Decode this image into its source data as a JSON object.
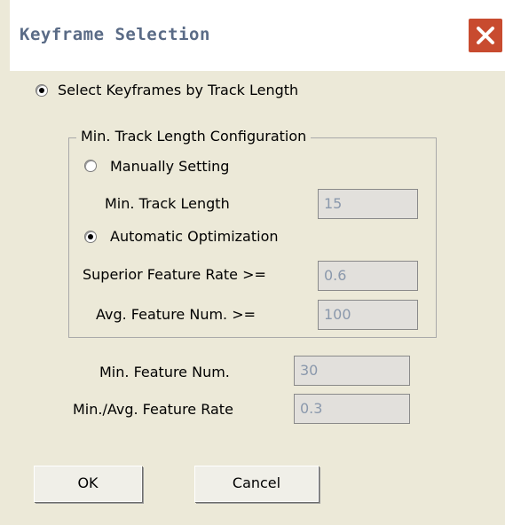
{
  "window": {
    "title": "Keyframe Selection",
    "close_icon": "close-icon",
    "close_color": "#c84b2f"
  },
  "mode_radio": {
    "label": "Select Keyframes by Track Length",
    "selected": true
  },
  "group": {
    "title": "Min. Track Length Configuration",
    "manual": {
      "label": "Manually Setting",
      "selected": false,
      "min_track_length_label": "Min. Track Length",
      "min_track_length_value": "15"
    },
    "automatic": {
      "label": "Automatic Optimization",
      "selected": true,
      "superior_rate_label": "Superior Feature Rate >=",
      "superior_rate_value": "0.6",
      "avg_feature_num_label": "Avg. Feature Num. >=",
      "avg_feature_num_value": "100"
    }
  },
  "min_feature_num_label": "Min. Feature Num.",
  "min_feature_num_value": "30",
  "min_avg_rate_label": "Min./Avg. Feature Rate",
  "min_avg_rate_value": "0.3",
  "buttons": {
    "ok": "OK",
    "cancel": "Cancel"
  }
}
